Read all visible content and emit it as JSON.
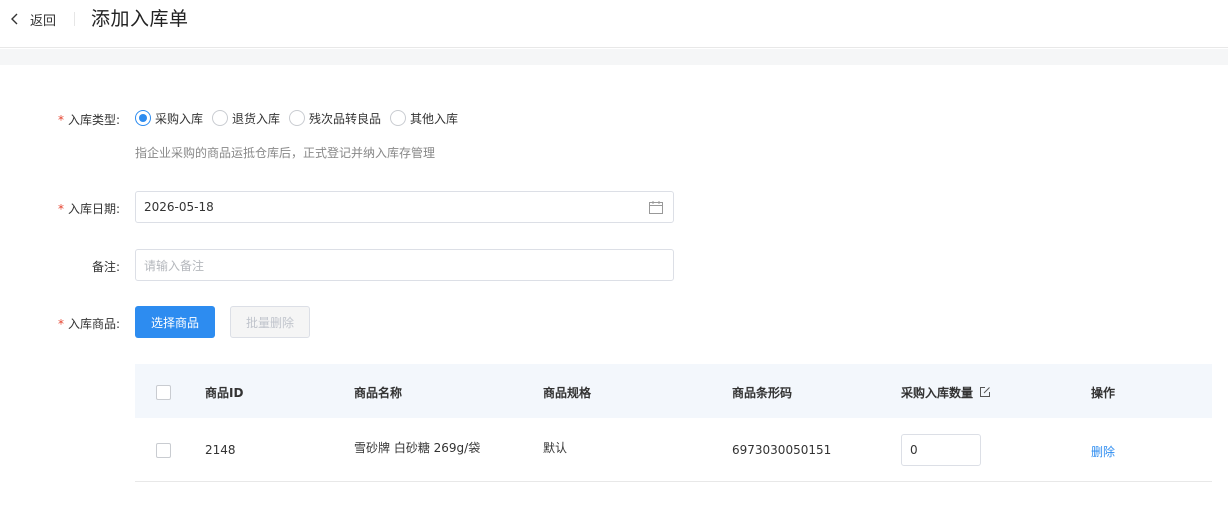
{
  "header": {
    "back_label": "返回",
    "title": "添加入库单"
  },
  "form": {
    "type": {
      "label": "入库类型:",
      "options": [
        "采购入库",
        "退货入库",
        "残次品转良品",
        "其他入库"
      ],
      "selected": "采购入库",
      "hint": "指企业采购的商品运抵仓库后，正式登记并纳入库存管理"
    },
    "date": {
      "label": "入库日期:",
      "value": "2026-05-18"
    },
    "remark": {
      "label": "备注:",
      "placeholder": "请输入备注",
      "value": ""
    },
    "goods": {
      "label": "入库商品:",
      "select_button": "选择商品",
      "batch_delete_button": "批量删除"
    }
  },
  "table": {
    "headers": {
      "id": "商品ID",
      "name": "商品名称",
      "spec": "商品规格",
      "barcode": "商品条形码",
      "qty": "采购入库数量",
      "ops": "操作"
    },
    "rows": [
      {
        "id": "2148",
        "name": "雪砂牌 白砂糖 269g/袋",
        "spec": "默认",
        "barcode": "6973030050151",
        "qty": "0",
        "op": "删除"
      }
    ]
  },
  "colors": {
    "primary": "#2d8cf0",
    "required": "#e5432f",
    "table_header_bg": "#f3f7fc"
  },
  "icons": [
    "chevron-left-icon",
    "calendar-icon",
    "edit-icon"
  ]
}
